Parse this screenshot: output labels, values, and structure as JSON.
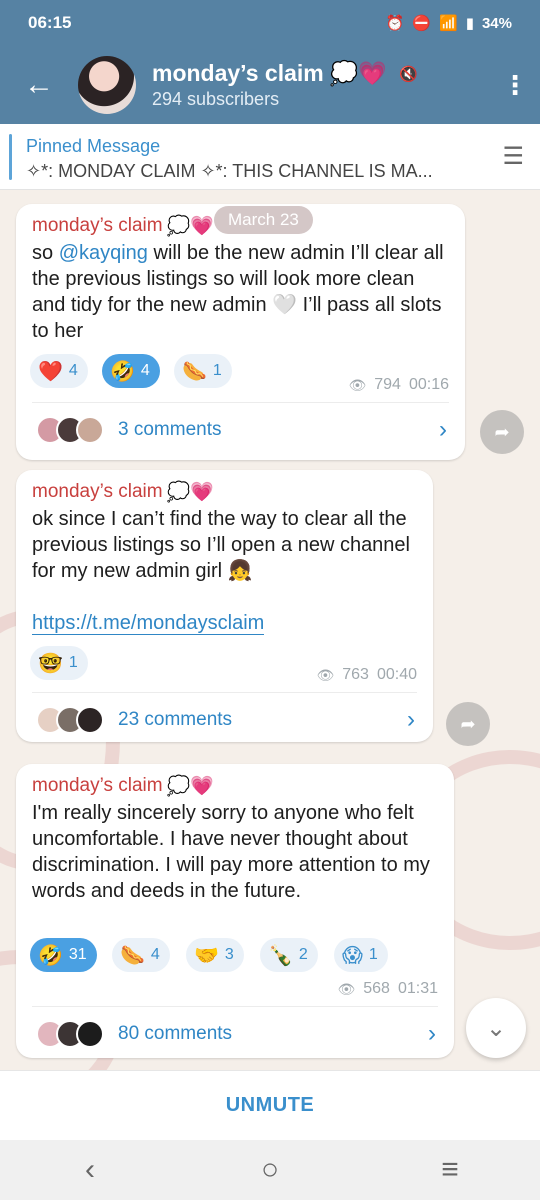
{
  "status_bar": {
    "time": "06:15",
    "battery": "34%"
  },
  "header": {
    "title": "monday’s claim",
    "title_emoji": "💭💗",
    "subscribers": "294 subscribers"
  },
  "pinned": {
    "title": "Pinned Message",
    "text": "✧*: MONDAY CLAIM ✧*:  THIS CHANNEL IS MA..."
  },
  "date_pill": "March 23",
  "messages": [
    {
      "author": "monday’s claim",
      "author_emoji": "💭💗",
      "text_pre": "so ",
      "mention": "@kayqing",
      "text_post": " will be the new admin I’ll clear all the previous listings so will look more clean and tidy for the new admin 🤍 I’ll pass all slots to her",
      "reactions": [
        {
          "emoji": "❤️",
          "count": "4"
        },
        {
          "emoji": "🤣",
          "count": "4"
        },
        {
          "emoji": "🌭",
          "count": "1"
        }
      ],
      "views": "794",
      "time": "00:16",
      "comments": "3 comments"
    },
    {
      "author": "monday’s claim",
      "author_emoji": "💭💗",
      "text": "ok since I can’t find the way to clear all the previous listings so I’ll open a new channel for my new admin girl 👧",
      "link": "https://t.me/mondaysclaim",
      "reactions": [
        {
          "emoji": "🤓",
          "count": "1"
        }
      ],
      "views": "763",
      "time": "00:40",
      "comments": "23 comments"
    },
    {
      "author": "monday’s claim",
      "author_emoji": "💭💗",
      "text": "I'm really sincerely sorry to anyone who felt uncomfortable. I have never thought about discrimination. I will pay more attention to my words and deeds in the future.",
      "reactions": [
        {
          "emoji": "🤣",
          "count": "31"
        },
        {
          "emoji": "🌭",
          "count": "4"
        },
        {
          "emoji": "🤝",
          "count": "3"
        },
        {
          "emoji": "🍾",
          "count": "2"
        },
        {
          "emoji": "😱",
          "count": "1"
        }
      ],
      "views": "568",
      "time": "01:31",
      "comments": "80 comments"
    }
  ],
  "unmute_label": "UNMUTE",
  "colors": {
    "header": "#5682a3",
    "accent": "#3a8fcc",
    "author": "#c8403e"
  }
}
